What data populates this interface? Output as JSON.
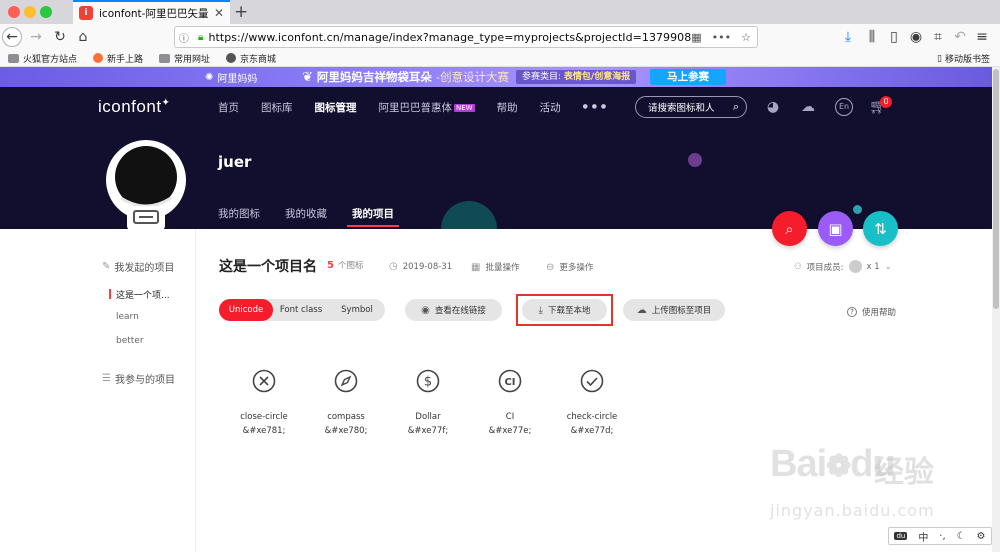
{
  "browser": {
    "tab_title": "iconfont-阿里巴巴矢量图标库",
    "url": "https://www.iconfont.cn/manage/index?manage_type=myprojects&projectId=1379908",
    "bookmarks": [
      "火狐官方站点",
      "新手上路",
      "常用网址",
      "京东商城"
    ],
    "mobile_bookmarks": "移动版书签"
  },
  "ad": {
    "logo_text": "阿里妈妈",
    "title": "阿里妈妈吉祥物袋耳朵",
    "title_sub": "-创意设计大赛",
    "tag_prefix": "参赛类目:",
    "tag_value": "表情包/创意海报",
    "button": "马上参赛"
  },
  "header": {
    "logo": "iconfont",
    "nav": [
      "首页",
      "图标库",
      "图标管理",
      "阿里巴巴普惠体",
      "帮助",
      "活动"
    ],
    "nav_new_badge": "NEW",
    "nav_more": "● ● ●",
    "search_placeholder": "请搜索图标和人",
    "lang": "En",
    "cart_count": "0"
  },
  "user": {
    "name": "juer",
    "tabs": [
      "我的图标",
      "我的收藏",
      "我的项目"
    ]
  },
  "sidebar": {
    "created_heading": "我发起的项目",
    "created_items": [
      "这是一个项...",
      "learn",
      "better"
    ],
    "joined_heading": "我参与的项目"
  },
  "project": {
    "title": "这是一个项目名",
    "count": "5",
    "count_unit": "个图标",
    "date": "2019-08-31",
    "batch": "批量操作",
    "more": "更多操作",
    "members_label": "项目成员:",
    "members_count": "x 1",
    "modes": [
      "Unicode",
      "Font class",
      "Symbol"
    ],
    "view_online": "查看在线链接",
    "download": "下载至本地",
    "upload": "上传图标至项目",
    "help": "使用帮助"
  },
  "icons": [
    {
      "name": "close-circle",
      "code": "&#xe781;"
    },
    {
      "name": "compass",
      "code": "&#xe780;"
    },
    {
      "name": "Dollar",
      "code": "&#xe77f;"
    },
    {
      "name": "CI",
      "code": "&#xe77e;"
    },
    {
      "name": "check-circle",
      "code": "&#xe77d;"
    }
  ],
  "watermark": {
    "brand": "Bai",
    "brand2": "du",
    "cn": "经验",
    "url": "jingyan.baidu.com"
  },
  "ime": {
    "mode": "中"
  },
  "colors": {
    "accent_red": "#f51d2c",
    "header_bg": "#120f2e",
    "fab_red": "#f51d2c",
    "fab_purple": "#9b5cf6",
    "fab_teal": "#18bfc6"
  }
}
